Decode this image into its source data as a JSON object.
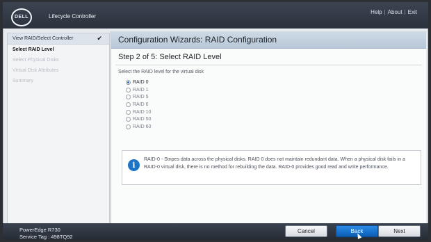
{
  "header": {
    "logo_text": "DELL",
    "product_name": "Lifecycle Controller",
    "links": [
      "Help",
      "About",
      "Exit"
    ]
  },
  "sidebar": {
    "items": [
      {
        "label": "View RAID/Select Controller",
        "state": "completed"
      },
      {
        "label": "Select RAID Level",
        "state": "current"
      },
      {
        "label": "Select Physical Disks",
        "state": "disabled"
      },
      {
        "label": "Virtual Disk Attributes",
        "state": "disabled"
      },
      {
        "label": "Summary",
        "state": "disabled"
      }
    ]
  },
  "main": {
    "page_title": "Configuration Wizards: RAID Configuration",
    "step_title": "Step 2 of 5: Select RAID Level",
    "instruction": "Select the RAID level for the virtual disk",
    "raid_options": [
      "RAID 0",
      "RAID 1",
      "RAID 5",
      "RAID 6",
      "RAID 10",
      "RAID 50",
      "RAID 60"
    ],
    "selected_raid": "RAID 0",
    "info_text": "RAID-0 - Stripes data across the physical disks. RAID 0 does not maintain redundant data. When a physical disk fails in a RAID-0 virtual disk, there is no method for rebuilding the data. RAID-0 provides good read and write performance."
  },
  "footer": {
    "model": "PowerEdge R730",
    "service_tag": "Service Tag : 498TQ92",
    "buttons": {
      "cancel": "Cancel",
      "back": "Back",
      "next": "Next"
    }
  },
  "colors": {
    "accent": "#1d74c7",
    "header_bg": "#3c4452",
    "footer_bg": "#2b323d"
  }
}
